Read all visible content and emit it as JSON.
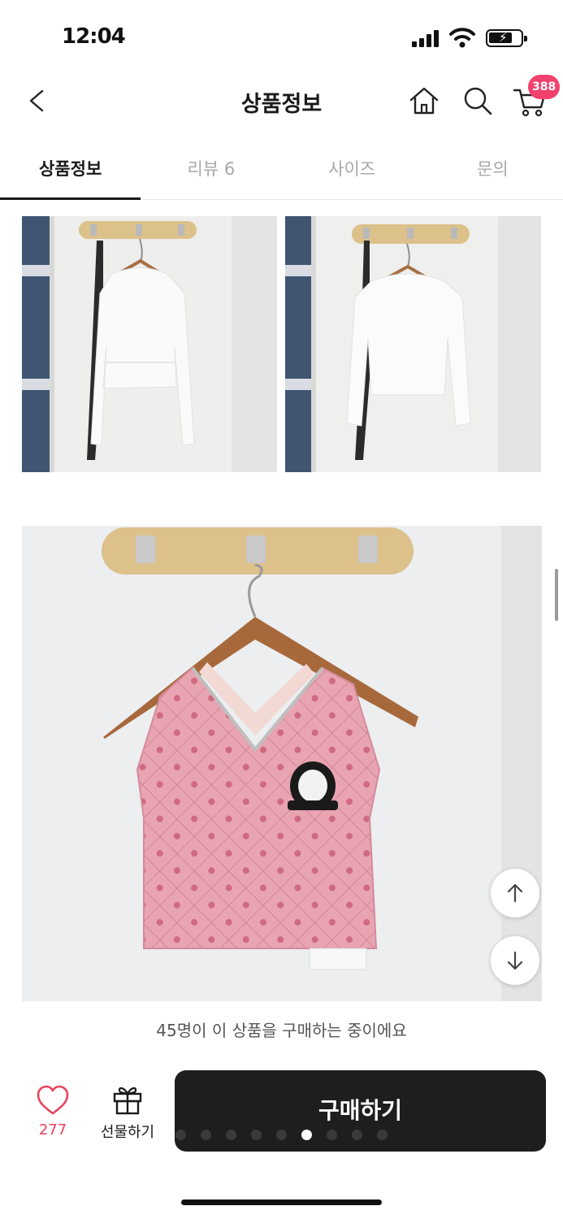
{
  "status_bar": {
    "time": "12:04"
  },
  "header": {
    "title": "상품정보",
    "icons": [
      "back-arrow-icon",
      "home-icon",
      "search-icon",
      "cart-icon"
    ],
    "cart_badge": "388"
  },
  "tabs": [
    {
      "label": "상품정보",
      "active": true
    },
    {
      "label": "리뷰 6",
      "active": false
    },
    {
      "label": "사이즈",
      "active": false
    },
    {
      "label": "문의",
      "active": false
    }
  ],
  "photos": [
    "white-cropped-shirt-with-tie-front-photo",
    "white-cropped-shirt-with-tie-back-photo",
    "pink-bow-print-crop-vest-photo"
  ],
  "bottom": {
    "purchase_notice": "45명이 이 상품을 구매하는 중이에요",
    "like_count": "277",
    "gift_label": "선물하기",
    "buy_label": "구매하기",
    "carousel_dots": 9,
    "carousel_active_index": 5
  },
  "colors": {
    "accent_pink": "#f1416c",
    "like_red": "#e8435d",
    "buy_button": "#1e1e1e"
  }
}
